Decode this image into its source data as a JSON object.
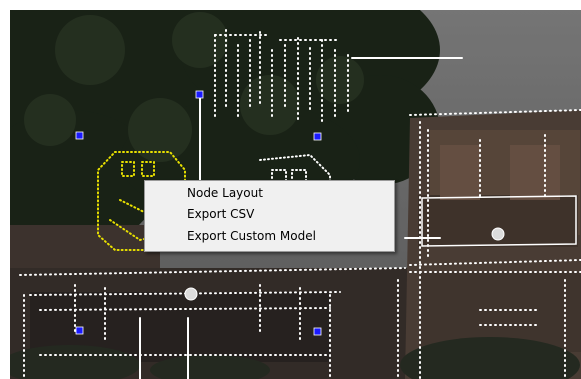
{
  "context_menu": {
    "items": [
      {
        "label": "Node Layout"
      },
      {
        "label": "Export CSV"
      },
      {
        "label": "Export Custom Model"
      }
    ]
  },
  "colors": {
    "dots_white": "#ffffff",
    "dots_yellow": "#e8e000",
    "node_blue": "#1a1aff",
    "menu_bg": "#f0f0f0",
    "menu_hover": "#cce8ff"
  }
}
